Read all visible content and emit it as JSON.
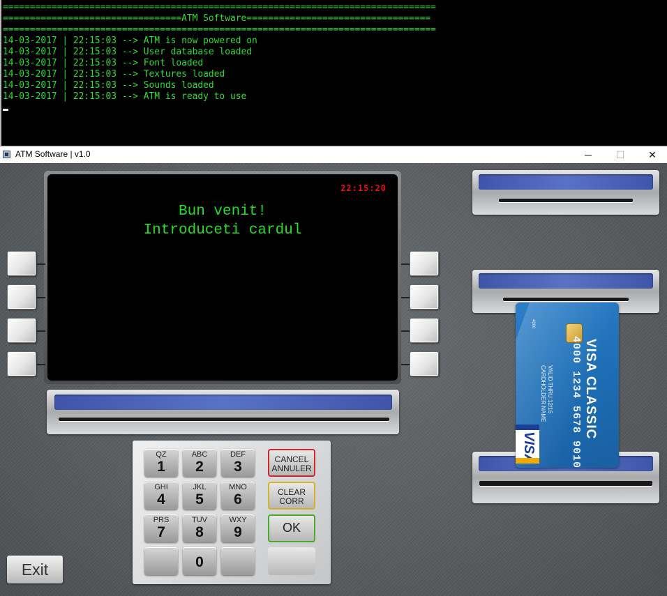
{
  "console": {
    "lines": [
      "================================================================================",
      "=================================ATM Software==================================",
      "================================================================================",
      "14-03-2017 | 22:15:03 --> ATM is now powered on",
      "14-03-2017 | 22:15:03 --> User database loaded",
      "14-03-2017 | 22:15:03 --> Font loaded",
      "14-03-2017 | 22:15:03 --> Textures loaded",
      "14-03-2017 | 22:15:03 --> Sounds loaded",
      "14-03-2017 | 22:15:03 --> ATM is ready to use"
    ]
  },
  "window": {
    "title": "ATM Software | v1.0",
    "minimize": "─",
    "maximize": "☐",
    "close": "✕"
  },
  "screen": {
    "clock": "22:15:20",
    "line1": "Bun venit!",
    "line2": "Introduceti cardul"
  },
  "keypad": {
    "keys": [
      {
        "letters": "QZ",
        "digit": "1"
      },
      {
        "letters": "ABC",
        "digit": "2"
      },
      {
        "letters": "DEF",
        "digit": "3"
      },
      {
        "letters": "GHI",
        "digit": "4"
      },
      {
        "letters": "JKL",
        "digit": "5"
      },
      {
        "letters": "MNO",
        "digit": "6"
      },
      {
        "letters": "PRS",
        "digit": "7"
      },
      {
        "letters": "TUV",
        "digit": "8"
      },
      {
        "letters": "WXY",
        "digit": "9"
      },
      {
        "letters": "",
        "digit": ""
      },
      {
        "letters": "",
        "digit": "0"
      },
      {
        "letters": "",
        "digit": ""
      }
    ],
    "cancel": {
      "line1": "CANCEL",
      "line2": "ANNULER",
      "border": "#c8282a"
    },
    "clear": {
      "line1": "CLEAR",
      "line2": "CORR",
      "border": "#d8b22a"
    },
    "ok": {
      "label": "OK",
      "border": "#4aa82a"
    }
  },
  "card": {
    "brand": "VISA CLASSIC",
    "number": "4000 1234 5678 9010",
    "expiry": "VALID THRU 12/16",
    "holder": "CARDHOLDER NAME",
    "small": "4000",
    "logo": "VISA"
  },
  "exit_label": "Exit"
}
